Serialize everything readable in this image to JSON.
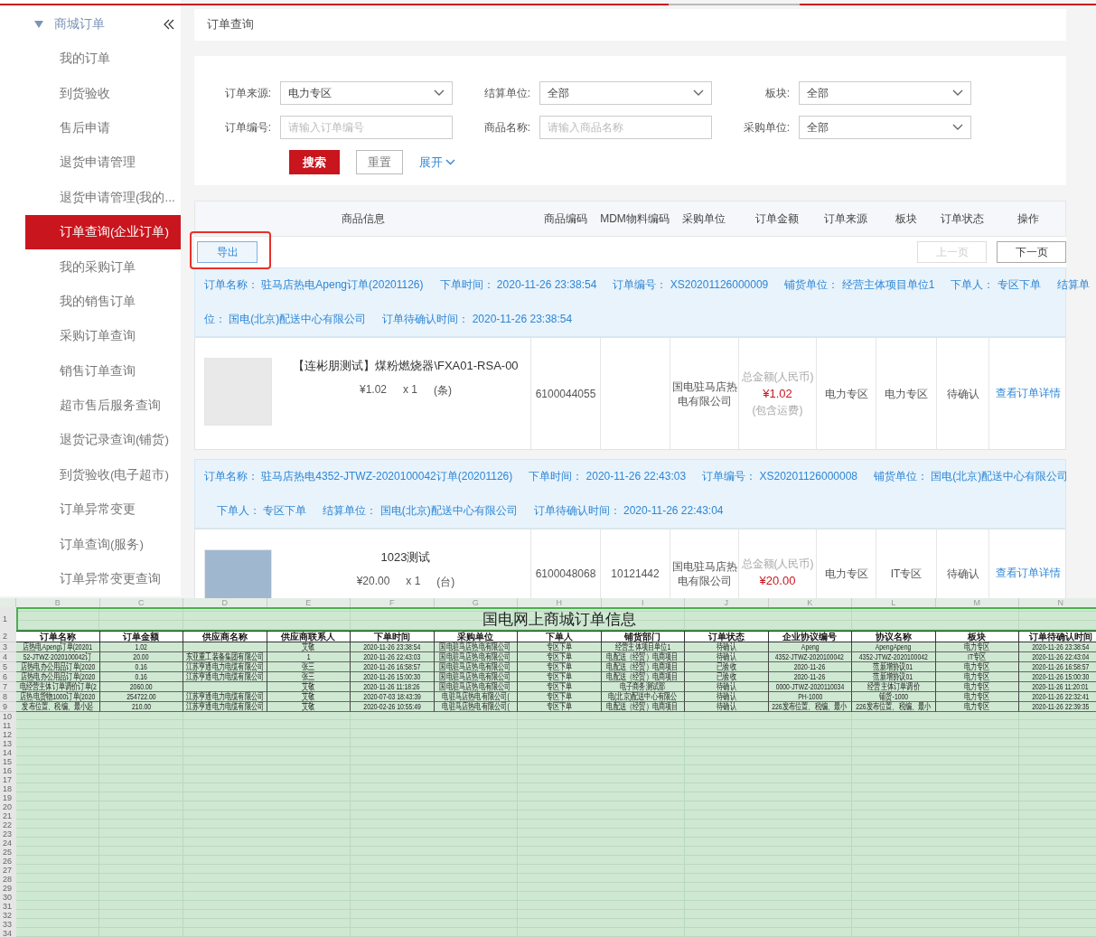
{
  "sidebar": {
    "title": "商城订单",
    "items": [
      {
        "label": "我的订单",
        "selected": false
      },
      {
        "label": "到货验收",
        "selected": false
      },
      {
        "label": "售后申请",
        "selected": false
      },
      {
        "label": "退货申请管理",
        "selected": false
      },
      {
        "label": "退货申请管理(我的...",
        "selected": false
      },
      {
        "label": "订单查询(企业订单)",
        "selected": true
      },
      {
        "label": "我的采购订单",
        "selected": false
      },
      {
        "label": "我的销售订单",
        "selected": false
      },
      {
        "label": "采购订单查询",
        "selected": false
      },
      {
        "label": "销售订单查询",
        "selected": false
      },
      {
        "label": "超市售后服务查询",
        "selected": false
      },
      {
        "label": "退货记录查询(铺货)",
        "selected": false
      },
      {
        "label": "到货验收(电子超市)",
        "selected": false
      },
      {
        "label": "订单异常变更",
        "selected": false
      },
      {
        "label": "订单查询(服务)",
        "selected": false
      },
      {
        "label": "订单异常变更查询",
        "selected": false
      }
    ]
  },
  "breadcrumb": "订单查询",
  "filters": [
    {
      "label": "订单来源:",
      "kind": "select",
      "value": "电力专区"
    },
    {
      "label": "结算单位:",
      "kind": "select",
      "value": "全部"
    },
    {
      "label": "板块:",
      "kind": "select",
      "value": "全部"
    },
    {
      "label": "订单编号:",
      "kind": "input",
      "placeholder": "请输入订单编号"
    },
    {
      "label": "商品名称:",
      "kind": "input",
      "placeholder": "请输入商品名称"
    },
    {
      "label": "采购单位:",
      "kind": "select",
      "value": "全部"
    }
  ],
  "search_button": "搜索",
  "reset_button": "重置",
  "expand_link": "展开",
  "table_columns": [
    "商品信息",
    "商品编码",
    "MDM物料编码",
    "采购单位",
    "订单金额",
    "订单来源",
    "板块",
    "订单状态",
    "操作"
  ],
  "export_button": {
    "label": "导出",
    "highlighted": true
  },
  "pagination": [
    {
      "label": "上一页",
      "disabled": true
    },
    {
      "label": "下一页",
      "disabled": false
    }
  ],
  "orders": [
    {
      "header_lines": [
        [
          {
            "label": "订单名称：",
            "value": "驻马店热电Apeng订单(20201126)"
          },
          {
            "label": "下单时间：",
            "value": "2020-11-26 23:38:54"
          },
          {
            "label": "订单编号：",
            "value": "XS20201126000009"
          },
          {
            "label": "铺货单位：",
            "value": "经营主体项目单位1"
          },
          {
            "label": "下单人：",
            "value": "专区下单"
          },
          {
            "label": "结算单"
          }
        ],
        [
          {
            "label": "位：",
            "value": "国电(北京)配送中心有限公司"
          },
          {
            "label": "订单待确认时间：",
            "value": "2020-11-26 23:38:54"
          }
        ]
      ],
      "product": {
        "name": "【连彬朋测试】煤粉燃烧器\\FXA01-RSA-00",
        "price": "¥1.02",
        "quantity": "x 1",
        "unit": "(条)",
        "code": "6100044055",
        "buyer": "国电驻马店热电有限公司",
        "amount_label": "总金额(人民币)",
        "amount": "¥1.02",
        "shipping_note": "(包含运费)",
        "source": "电力专区",
        "sector": "电力专区",
        "status": "待确认",
        "action": "查看订单详情"
      }
    },
    {
      "header_lines": [
        [
          {
            "label": "订单名称：",
            "value": "驻马店热电4352-JTWZ-2020100042订单(20201126)"
          },
          {
            "label": "下单时间：",
            "value": "2020-11-26 22:43:03"
          },
          {
            "label": "订单编号：",
            "value": "XS20201126000008"
          },
          {
            "label": "铺货单位：",
            "value": "国电(北京)配送中心有限公司"
          }
        ],
        [
          {
            "label": "下单人：",
            "value": "专区下单"
          },
          {
            "label": "结算单位：",
            "value": "国电(北京)配送中心有限公司"
          },
          {
            "label": "订单待确认时间：",
            "value": "2020-11-26 22:43:04"
          }
        ]
      ],
      "product": {
        "name": "1023测试",
        "price": "¥20.00",
        "quantity": "x 1",
        "unit": "(台)",
        "code": "6100048068",
        "mdm": "10121442",
        "buyer": "国电驻马店热电有限公司",
        "amount_label": "总金额(人民币)",
        "amount": "¥20.00",
        "source": "电力专区",
        "sector": "IT专区",
        "status": "待确认",
        "action": "查看订单详情"
      }
    }
  ],
  "spreadsheet": {
    "column_letters": [
      "B",
      "C",
      "D",
      "E",
      "F",
      "G",
      "H",
      "I",
      "J",
      "K",
      "L",
      "M",
      "N"
    ],
    "row_numbers": [
      "1",
      "2",
      "3",
      "4",
      "5",
      "6",
      "7",
      "8",
      "9",
      "10",
      "11",
      "12",
      "13",
      "14",
      "15",
      "16",
      "17",
      "18",
      "19",
      "20",
      "21",
      "22",
      "23",
      "24",
      "25",
      "26",
      "27",
      "28",
      "29",
      "30",
      "31",
      "32",
      "33",
      "34"
    ],
    "title": "国电网上商城订单信息",
    "headers": [
      "订单名称",
      "订单金额",
      "供应商名称",
      "供应商联系人",
      "下单时间",
      "采购单位",
      "下单人",
      "铺货部门",
      "订单状态",
      "企业协议编号",
      "协议名称",
      "板块",
      "订单待确认时间"
    ],
    "rows": [
      [
        "店热电Apeng订单(20201",
        "1.02",
        null,
        "艾敬",
        "2020-11-26 23:38:54",
        "国电驻马店热电有限公司",
        "专区下单",
        "经营主体项目单位1",
        "待确认",
        "Apeng",
        "ApengApeng",
        "电力专区",
        "2020-11-26 23:38:54"
      ],
      [
        "52-JTWZ-2020100042订",
        "20.00",
        "东亚重工装备集团有限公司",
        "1",
        "2020-11-26 22:43:03",
        "国电驻马店热电有限公司",
        "专区下单",
        "电配送（经贸）电商项目",
        "待确认",
        "4352-JTWZ-2020100042",
        "4352-JTWZ-2020100042",
        "IT专区",
        "2020-11-26 22:43:04"
      ],
      [
        "店热电办公用品订单(2020",
        "0.16",
        "江苏亨通电力电缆有限公司",
        "张三",
        "2020-11-26 16:58:57",
        "国电驻马店热电有限公司",
        "专区下单",
        "电配送（经贸）电商项目",
        "已验收",
        "2020-11-26",
        "范新增协议01",
        "电力专区",
        "2020-11-26 16:58:57"
      ],
      [
        "店热电办公用品订单(2020",
        "0.16",
        "江苏亨通电力电缆有限公司",
        "张三",
        "2020-11-26 15:00:30",
        "国电驻马店热电有限公司",
        "专区下单",
        "电配送（经贸）电商项目",
        "已验收",
        "2020-11-26",
        "范新增协议01",
        "电力专区",
        "2020-11-26 15:00:30"
      ],
      [
        "电经营主体订单调价订单(2",
        "2060.00",
        null,
        "艾敬",
        "2020-11-26 11:18:26",
        "国电驻马店热电有限公司",
        "专区下单",
        "电子商务测试部",
        "待确认",
        "0000-JTWZ-2020110034",
        "经营主体订单调价",
        "电力专区",
        "2020-11-26 11:20:01"
      ],
      [
        "店热电货物1000订单(2020",
        "254722.00",
        "江苏亨通电力电缆有限公司",
        "艾敬",
        "2020-07-03 18:43:39",
        "电驻马店热电有限公司(",
        "专区下单",
        "电(北京)配送中心有限公",
        "待确认",
        "PH-1000",
        "铺货-1000",
        "电力专区",
        "2020-11-26 22:32:41"
      ],
      [
        "发布位置、税编、最小起",
        "210.00",
        "江苏亨通电力电缆有限公司",
        "艾敬",
        "2020-02-26 10:55:49",
        "电驻马店热电有限公司(",
        "专区下单",
        "电配送（经贸）电商项目",
        "待确认",
        "226发布位置、税编、最小",
        "226发布位置、税编、最小",
        "电力专区",
        "2020-11-26 22:39:35"
      ]
    ]
  }
}
